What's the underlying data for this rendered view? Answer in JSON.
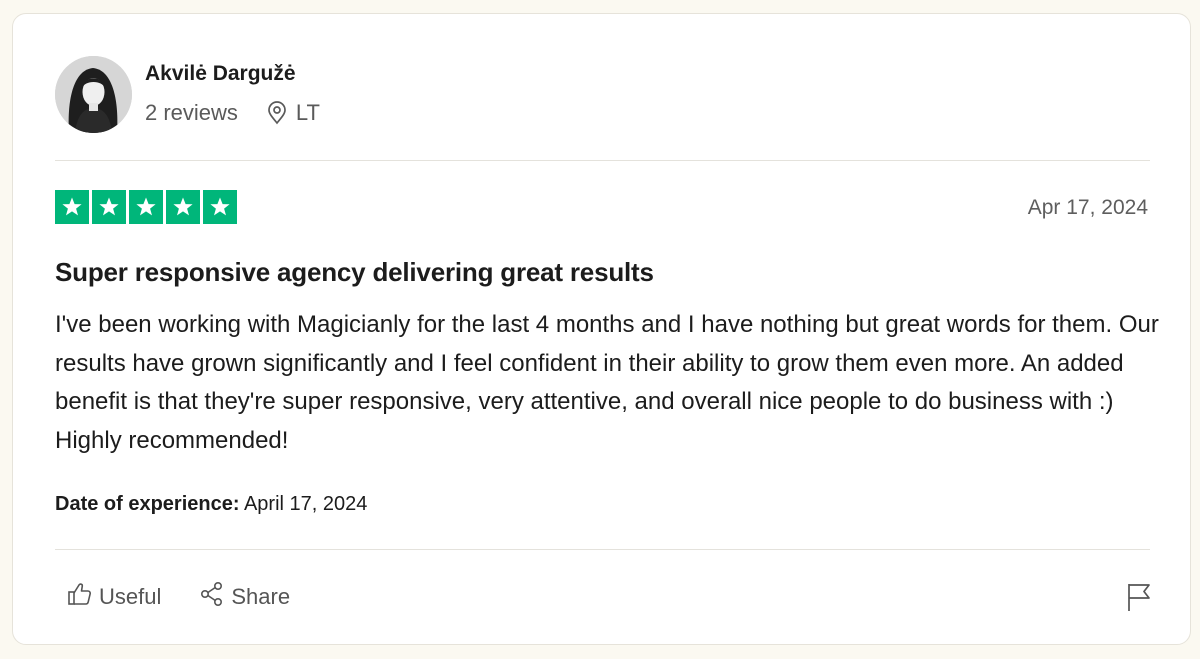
{
  "reviewer": {
    "name": "Akvilė Dargužė",
    "reviews": "2 reviews",
    "country": "LT"
  },
  "review": {
    "rating": 5,
    "rating_max": 5,
    "date": "Apr 17, 2024",
    "title": "Super responsive agency delivering great results",
    "body": "I've been working with Magicianly for the last 4 months and I have nothing but great words for them. Our results have grown significantly and I feel confident in their ability to grow them even more. An added benefit is that they're super responsive, very attentive, and overall nice people to do business with :) Highly recommended!",
    "experience_label": "Date of experience:",
    "experience_date": "April 17, 2024"
  },
  "actions": {
    "useful_label": "Useful",
    "share_label": "Share"
  },
  "colors": {
    "star_green": "#00b67a",
    "page_bg": "#fbf9f1",
    "card_bg": "#ffffff"
  },
  "icons": {
    "location": "map-pin-icon",
    "useful": "thumbs-up-icon",
    "share": "share-icon",
    "report": "flag-icon"
  }
}
